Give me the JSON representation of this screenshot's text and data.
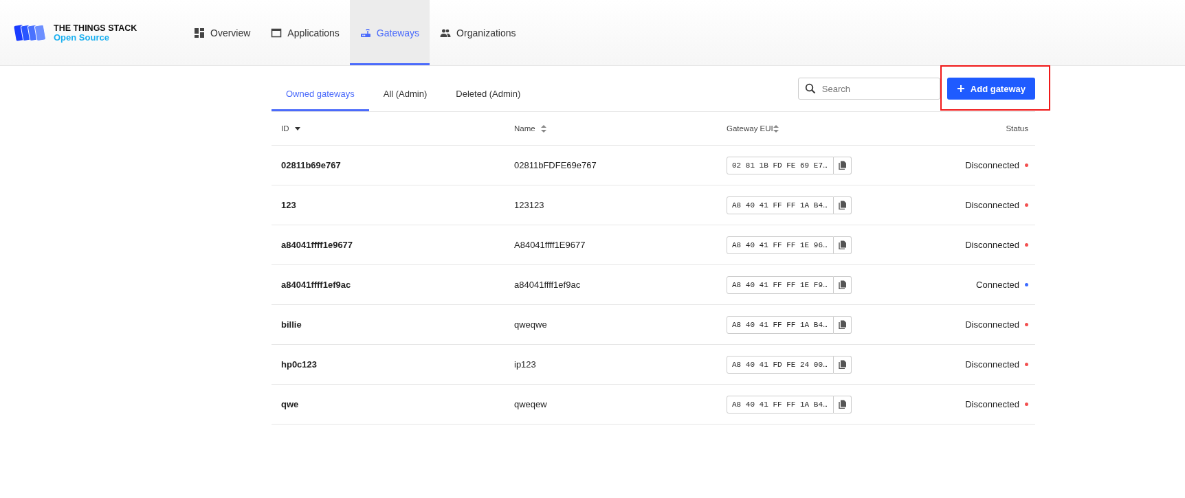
{
  "brand": {
    "title": "THE THINGS STACK",
    "subtitle": "Open Source"
  },
  "nav": [
    {
      "label": "Overview",
      "selected": false
    },
    {
      "label": "Applications",
      "selected": false
    },
    {
      "label": "Gateways",
      "selected": true
    },
    {
      "label": "Organizations",
      "selected": false
    }
  ],
  "tabs": [
    {
      "label": "Owned gateways",
      "selected": true
    },
    {
      "label": "All (Admin)",
      "selected": false
    },
    {
      "label": "Deleted (Admin)",
      "selected": false
    }
  ],
  "search": {
    "placeholder": "Search"
  },
  "add_button": {
    "label": "Add gateway",
    "highlighted": true
  },
  "table": {
    "columns": [
      {
        "label": "ID",
        "kind": "sorted"
      },
      {
        "label": "Name",
        "kind": "sortable"
      },
      {
        "label": "Gateway EUI",
        "kind": "sortable"
      },
      {
        "label": "Status",
        "kind": "plain"
      }
    ],
    "rows": [
      {
        "id": "02811b69e767",
        "name": "02811bFDFE69e767",
        "eui": "02 81 1B FD FE 69 E7…",
        "status": "Disconnected",
        "connected": false
      },
      {
        "id": "123",
        "name": "123123",
        "eui": "A8 40 41 FF FF 1A B4…",
        "status": "Disconnected",
        "connected": false
      },
      {
        "id": "a84041ffff1e9677",
        "name": "A84041ffff1E9677",
        "eui": "A8 40 41 FF FF 1E 96…",
        "status": "Disconnected",
        "connected": false
      },
      {
        "id": "a84041ffff1ef9ac",
        "name": "a84041ffff1ef9ac",
        "eui": "A8 40 41 FF FF 1E F9…",
        "status": "Connected",
        "connected": true
      },
      {
        "id": "billie",
        "name": "qweqwe",
        "eui": "A8 40 41 FF FF 1A B4…",
        "status": "Disconnected",
        "connected": false
      },
      {
        "id": "hp0c123",
        "name": "ip123",
        "eui": "A8 40 41 FD FE 24 00…",
        "status": "Disconnected",
        "connected": false
      },
      {
        "id": "qwe",
        "name": "qweqew",
        "eui": "A8 40 41 FF FF 1A B4…",
        "status": "Disconnected",
        "connected": false
      }
    ]
  }
}
